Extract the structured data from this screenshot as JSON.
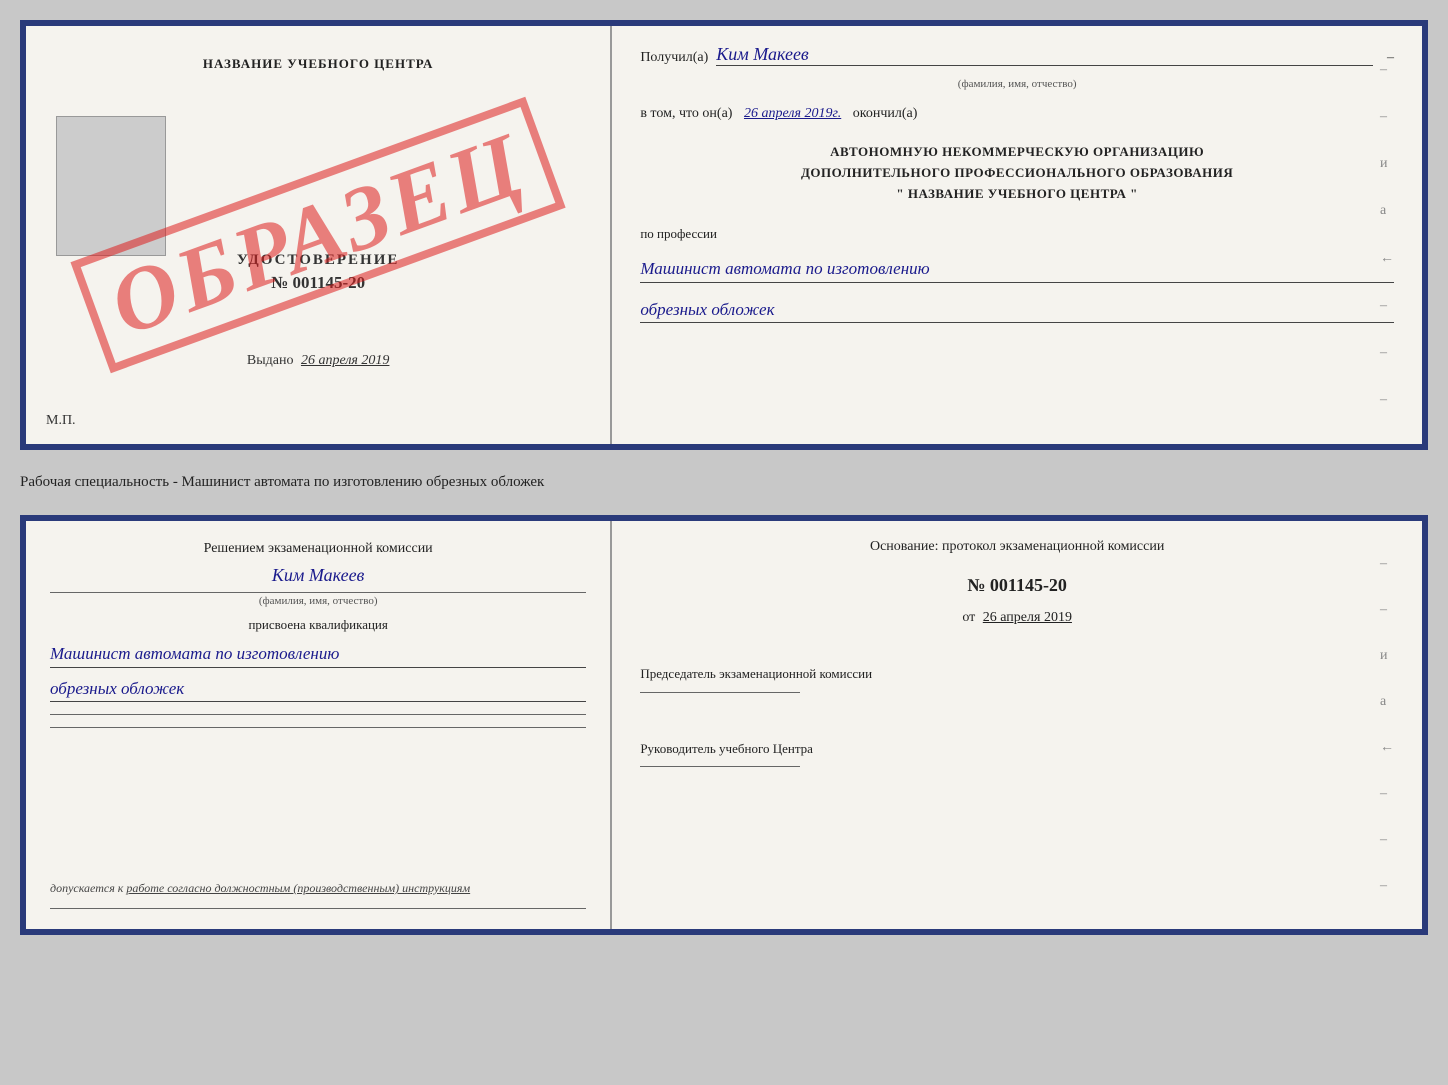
{
  "top_doc": {
    "left": {
      "cert_title": "НАЗВАНИЕ УЧЕБНОГО ЦЕНТРА",
      "cert_label": "УДОСТОВЕРЕНИЕ",
      "cert_number": "№ 001145-20",
      "cert_issued_label": "Выдано",
      "cert_issued_date": "26 апреля 2019",
      "cert_mp": "М.П.",
      "watermark": "ОБРАЗЕЦ"
    },
    "right": {
      "received_label": "Получил(а)",
      "received_name": "Ким Макеев",
      "received_sub": "(фамилия, имя, отчество)",
      "date_label": "в том, что он(а)",
      "date_value": "26 апреля 2019г.",
      "finished_label": "окончил(а)",
      "org_line1": "АВТОНОМНУЮ НЕКОММЕРЧЕСКУЮ ОРГАНИЗАЦИЮ",
      "org_line2": "ДОПОЛНИТЕЛЬНОГО ПРОФЕССИОНАЛЬНОГО ОБРАЗОВАНИЯ",
      "org_line3": "\"  НАЗВАНИЕ УЧЕБНОГО ЦЕНТРА  \"",
      "profession_label": "по профессии",
      "profession_line1": "Машинист автомата по изготовлению",
      "profession_line2": "обрезных обложек"
    }
  },
  "middle_label": "Рабочая специальность - Машинист автомата по изготовлению обрезных обложек",
  "bottom_doc": {
    "left": {
      "decision_title": "Решением экзаменационной комиссии",
      "name": "Ким Макеев",
      "name_sub": "(фамилия, имя, отчество)",
      "assigned_label": "присвоена квалификация",
      "assigned_line1": "Машинист автомата по изготовлению",
      "assigned_line2": "обрезных обложек",
      "allowed_text": "допускается к",
      "allowed_underline": "работе согласно должностным (производственным) инструкциям"
    },
    "right": {
      "basis_label": "Основание: протокол экзаменационной комиссии",
      "protocol_number": "№ 001145-20",
      "protocol_date_prefix": "от",
      "protocol_date": "26 апреля 2019",
      "chairman_label": "Председатель экзаменационной комиссии",
      "director_label": "Руководитель учебного Центра"
    }
  },
  "dashes": [
    "–",
    "–",
    "и",
    "а",
    "←",
    "–",
    "–",
    "–"
  ]
}
